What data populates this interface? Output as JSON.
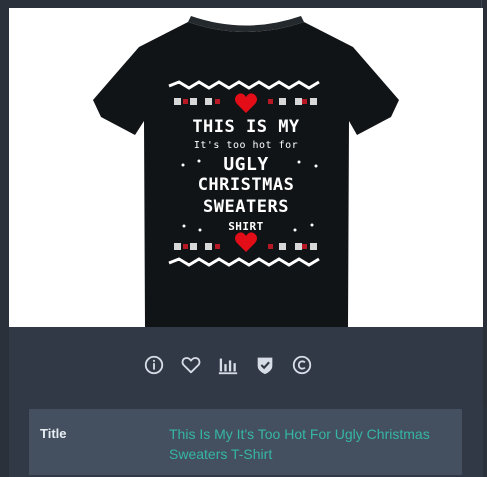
{
  "product": {
    "shirt_text": {
      "line1": "THIS IS MY",
      "line2": "It's too hot for",
      "line3": "UGLY",
      "line4": "CHRISTMAS",
      "line5": "SWEATERS",
      "line6": "SHIRT"
    }
  },
  "toolbar": {
    "icons": [
      "info-icon",
      "heart-icon",
      "bar-chart-icon",
      "shield-check-icon",
      "copyright-icon"
    ]
  },
  "details": {
    "title_label": "Title",
    "title_value": "This Is My It's Too Hot For Ugly Christmas Sweaters T-Shirt"
  },
  "colors": {
    "page_background": "#2b313b",
    "panel_background": "#323946",
    "row_background": "#44505f",
    "link_teal": "#35b6a6",
    "shirt_black": "#111417",
    "heart_red": "#e30d17"
  }
}
